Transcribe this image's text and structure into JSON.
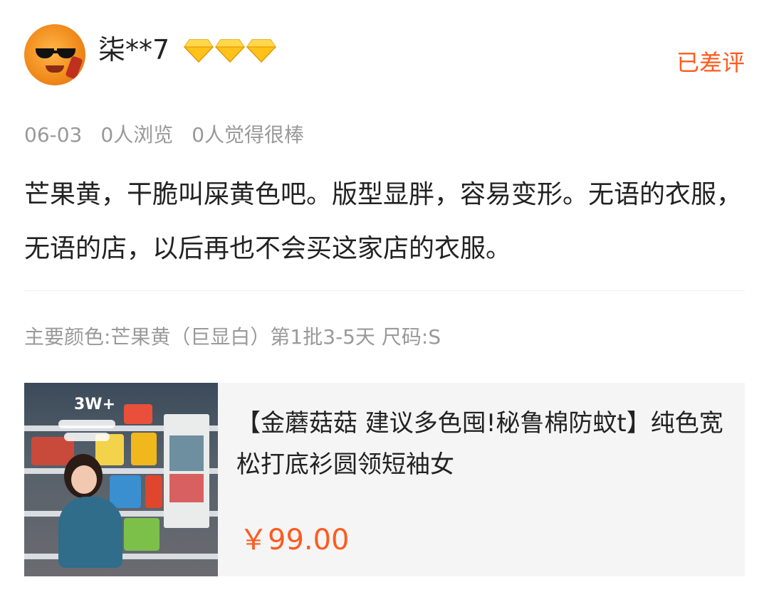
{
  "user": {
    "name": "柒**7",
    "level_icons": [
      "diamond-icon",
      "diamond-icon",
      "diamond-icon"
    ]
  },
  "status_label": "已差评",
  "meta": {
    "date": "06-03",
    "views": "0人浏览",
    "likes": "0人觉得很棒"
  },
  "review": {
    "text": "芒果黄，干脆叫屎黄色吧。版型显胖，容易变形。无语的衣服，无语的店，以后再也不会买这家店的衣服。"
  },
  "sku": "主要颜色:芒果黄（巨显白）第1批3-5天 尺码:S",
  "product": {
    "title": "【金蘑菇菇 建议多色囤!秘鲁棉防蚊t】纯色宽松打底衫圆领短袖女",
    "price": "￥99.00",
    "image_badge": "3W+"
  },
  "colors": {
    "accent": "#ff5a1f",
    "meta_gray": "#999999",
    "card_bg": "#f5f5f5",
    "diamond": "#ffc21a"
  }
}
